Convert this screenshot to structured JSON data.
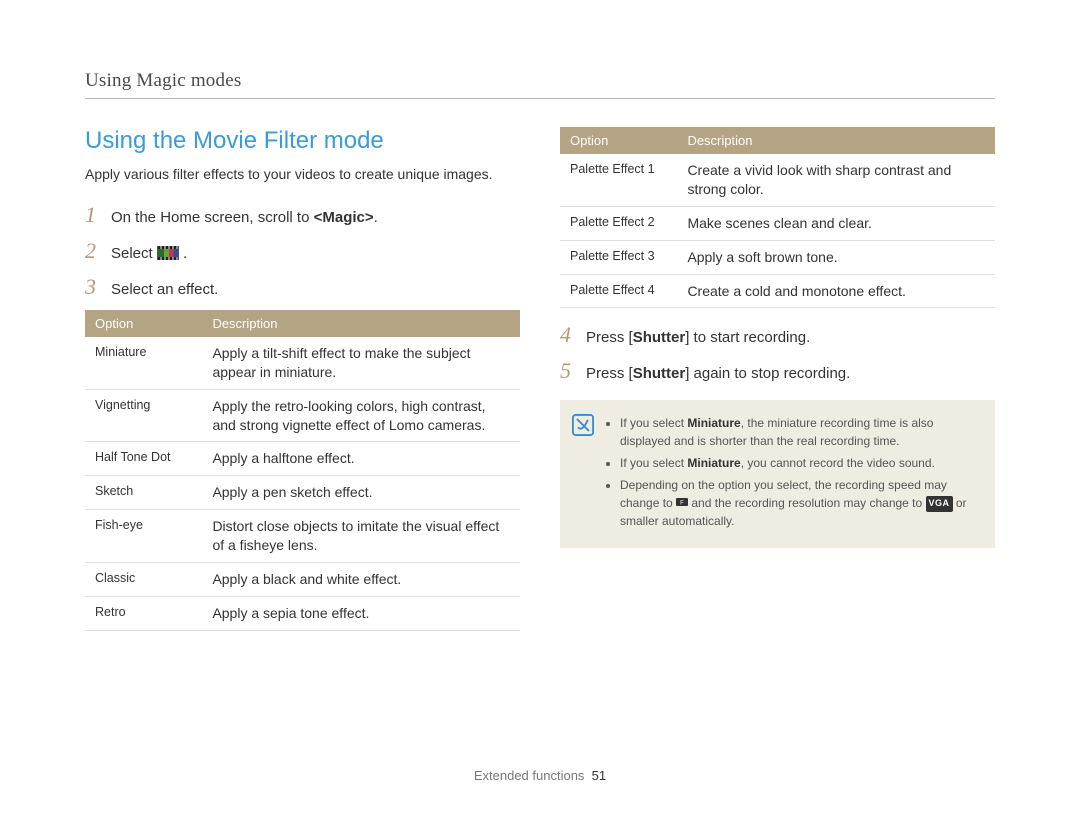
{
  "header": "Using Magic modes",
  "section_title": "Using the Movie Filter mode",
  "intro": "Apply various filter effects to your videos to create unique images.",
  "steps_left": [
    {
      "num": "1",
      "text_before": "On the Home screen, scroll to ",
      "bold": "<Magic>",
      "text_after": "."
    },
    {
      "num": "2",
      "text_before": "Select ",
      "icon": "movie",
      "text_after": " ."
    },
    {
      "num": "3",
      "text_before": "Select an effect.",
      "bold": "",
      "text_after": ""
    }
  ],
  "table_headers": {
    "option": "Option",
    "description": "Description"
  },
  "table_left": [
    {
      "opt": "Miniature",
      "desc": "Apply a tilt-shift effect to make the subject appear in miniature."
    },
    {
      "opt": "Vignetting",
      "desc": "Apply the retro-looking colors, high contrast, and strong vignette effect of Lomo cameras."
    },
    {
      "opt": "Half Tone Dot",
      "desc": "Apply a halftone effect."
    },
    {
      "opt": "Sketch",
      "desc": "Apply a pen sketch effect."
    },
    {
      "opt": "Fish-eye",
      "desc": "Distort close objects to imitate the visual effect of a fisheye lens."
    },
    {
      "opt": "Classic",
      "desc": "Apply a black and white effect."
    },
    {
      "opt": "Retro",
      "desc": "Apply a sepia tone effect."
    }
  ],
  "table_right": [
    {
      "opt": "Palette Effect 1",
      "desc": "Create a vivid look with sharp contrast and strong color."
    },
    {
      "opt": "Palette Effect 2",
      "desc": "Make scenes clean and clear."
    },
    {
      "opt": "Palette Effect 3",
      "desc": "Apply a soft brown tone."
    },
    {
      "opt": "Palette Effect 4",
      "desc": "Create a cold and monotone effect."
    }
  ],
  "steps_right": [
    {
      "num": "4",
      "text_before": "Press [",
      "bold": "Shutter",
      "text_after": "] to start recording."
    },
    {
      "num": "5",
      "text_before": "Press [",
      "bold": "Shutter",
      "text_after": "] again to stop recording."
    }
  ],
  "notes": {
    "line1_a": "If you select ",
    "line1_bold": "Miniature",
    "line1_b": ", the miniature recording time is also displayed and is shorter than the real recording time.",
    "line2_a": "If you select ",
    "line2_bold": "Miniature",
    "line2_b": ", you cannot record the video sound.",
    "line3_a": "Depending on the option you select, the recording speed may change to ",
    "line3_b": " and the recording resolution may change to ",
    "line3_vga": "VGA",
    "line3_c": " or smaller automatically."
  },
  "footer_label": "Extended functions",
  "footer_page": "51"
}
